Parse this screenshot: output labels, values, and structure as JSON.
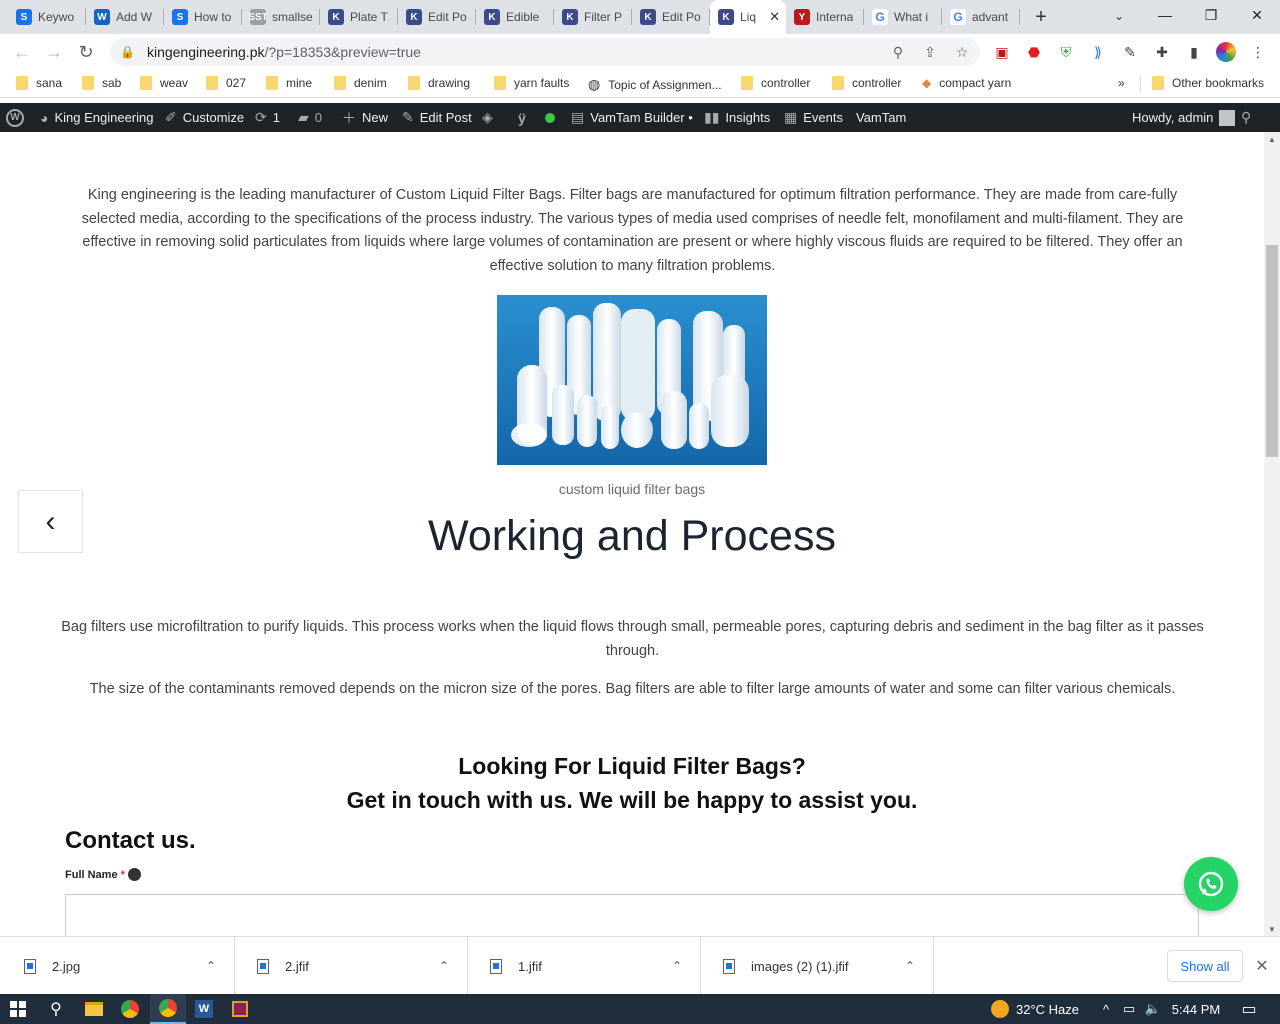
{
  "browser": {
    "tabs": [
      {
        "title": "Keywo",
        "favicon_color": "#1a73e8",
        "favicon_glyph": "S"
      },
      {
        "title": "Add W",
        "favicon_color": "#1565c0",
        "favicon_glyph": "W"
      },
      {
        "title": "How to",
        "favicon_color": "#1a73e8",
        "favicon_glyph": "S"
      },
      {
        "title": "smallse",
        "favicon_color": "#9e9e9e",
        "favicon_glyph": "SST"
      },
      {
        "title": "Plate T",
        "favicon_color": "#3c4a8a",
        "favicon_glyph": "K"
      },
      {
        "title": "Edit Po",
        "favicon_color": "#3c4a8a",
        "favicon_glyph": "K"
      },
      {
        "title": "Edible",
        "favicon_color": "#3c4a8a",
        "favicon_glyph": "K"
      },
      {
        "title": "Filter P",
        "favicon_color": "#3c4a8a",
        "favicon_glyph": "K"
      },
      {
        "title": "Edit Po",
        "favicon_color": "#3c4a8a",
        "favicon_glyph": "K"
      },
      {
        "title": "Liq",
        "favicon_color": "#3c4a8a",
        "favicon_glyph": "K",
        "active": true
      },
      {
        "title": "Interna",
        "favicon_color": "#b71c1c",
        "favicon_glyph": "Y"
      },
      {
        "title": "What i",
        "favicon_color": "#ffffff",
        "favicon_glyph": "G"
      },
      {
        "title": "advant",
        "favicon_color": "#ffffff",
        "favicon_glyph": "G"
      }
    ],
    "url_host": "kingengineering.pk",
    "url_path": "/?p=18353&preview=true",
    "bookmarks": [
      {
        "label": "sana",
        "icon": "folder-icon"
      },
      {
        "label": "sab",
        "icon": "folder-icon"
      },
      {
        "label": "weav",
        "icon": "folder-icon"
      },
      {
        "label": "027",
        "icon": "folder-icon"
      },
      {
        "label": "mine",
        "icon": "folder-icon"
      },
      {
        "label": "denim",
        "icon": "folder-icon"
      },
      {
        "label": "drawing",
        "icon": "folder-icon"
      },
      {
        "label": "yarn faults",
        "icon": "folder-icon"
      },
      {
        "label": "Topic of Assignmen...",
        "icon": "globe-icon"
      },
      {
        "label": "controller",
        "icon": "folder-icon"
      },
      {
        "label": "controller",
        "icon": "folder-icon"
      },
      {
        "label": "compact yarn",
        "icon": "site-icon"
      }
    ],
    "bookmarks_overflow": "»",
    "other_bookmarks": "Other bookmarks"
  },
  "wp_admin_bar": {
    "site_name": "King Engineering",
    "customize": "Customize",
    "updates_count": "1",
    "comments_count": "0",
    "new": "New",
    "edit_post": "Edit Post",
    "vamtam_builder": "VamTam Builder •",
    "insights": "Insights",
    "events": "Events",
    "vamtam": "VamTam",
    "howdy": "Howdy, admin"
  },
  "content": {
    "intro": "King engineering is the leading manufacturer of Custom Liquid Filter Bags.  Filter bags are manufactured for optimum filtration performance. They are made from care-fully selected media, according to the specifications of the process industry. The various types of media used comprises of needle felt, monofilament and multi-filament. They are effective in removing solid particulates from liquids where large volumes of contamination are present or where highly viscous fluids are required to be filtered. They offer an effective solution to many filtration problems.",
    "image_caption": "custom liquid filter bags",
    "section_heading": "Working and Process",
    "para1": "Bag filters use microfiltration to purify liquids. This process works when the liquid flows through small, permeable pores, capturing debris and sediment in the bag filter as it passes through.",
    "para2": "The size of the contaminants removed depends on the micron size of the pores. Bag filters are able to filter large amounts of water and some can filter various chemicals.",
    "cta_line1": "Looking For Liquid Filter Bags?",
    "cta_line2": "Get in touch with us. We will be happy to assist you.",
    "contact_heading": "Contact us.",
    "full_name_label": "Full Name",
    "required_mark": "*"
  },
  "downloads": {
    "files": [
      "2.jpg",
      "2.jfif",
      "1.jfif",
      "images (2) (1).jfif"
    ],
    "show_all": "Show all"
  },
  "taskbar": {
    "weather": "32°C  Haze",
    "time": "5:44 PM"
  }
}
